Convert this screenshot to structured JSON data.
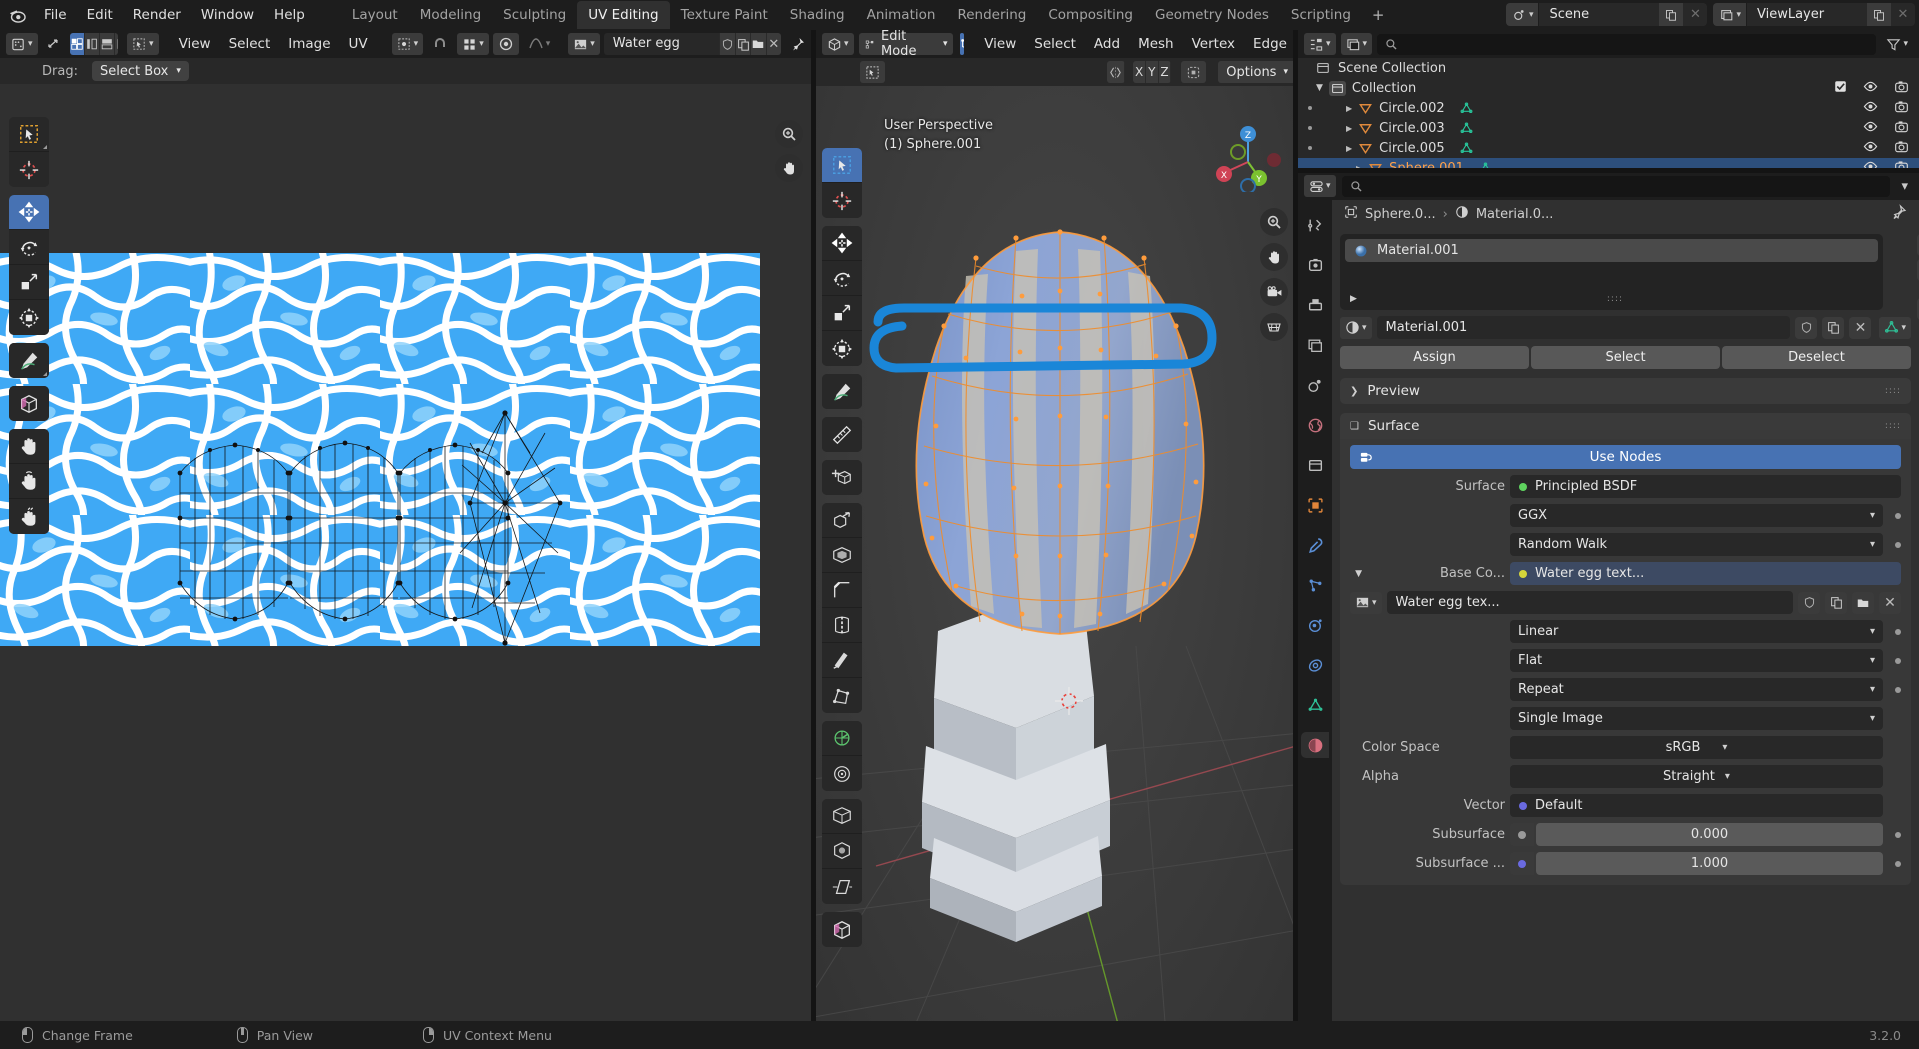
{
  "app": {
    "version": "3.2.0",
    "logo_icon": "blender-logo-icon"
  },
  "topbar": {
    "menus": [
      "File",
      "Edit",
      "Render",
      "Window",
      "Help"
    ],
    "workspaces": [
      {
        "label": "Layout",
        "active": false
      },
      {
        "label": "Modeling",
        "active": false
      },
      {
        "label": "Sculpting",
        "active": false
      },
      {
        "label": "UV Editing",
        "active": true
      },
      {
        "label": "Texture Paint",
        "active": false
      },
      {
        "label": "Shading",
        "active": false
      },
      {
        "label": "Animation",
        "active": false
      },
      {
        "label": "Rendering",
        "active": false
      },
      {
        "label": "Compositing",
        "active": false
      },
      {
        "label": "Geometry Nodes",
        "active": false
      },
      {
        "label": "Scripting",
        "active": false
      }
    ],
    "add_workspace_label": "+",
    "scene": {
      "name": "Scene",
      "icon": "scene-icon",
      "copy_label": "copy",
      "close_label": "×"
    },
    "viewlayer": {
      "name": "ViewLayer",
      "icon": "viewlayer-icon",
      "copy_label": "copy",
      "close_label": "×"
    }
  },
  "uv_editor": {
    "editor_type_icon": "uv-editor-icon",
    "menus": [
      "View",
      "Select",
      "Image",
      "UV"
    ],
    "image_name": "Water egg texture.jpg",
    "image_buttons": [
      "fake-user-shield-icon",
      "duplicate-icon",
      "open-folder-icon",
      "unlink-x-icon"
    ],
    "pin_icon": "pin-icon",
    "drag_label": "Drag:",
    "drag_value": "Select Box",
    "select_modes": [
      "vertex-select-icon",
      "edge-select-icon",
      "face-select-icon",
      "island-select-icon"
    ],
    "tools": [
      {
        "name": "tweak-select-box-tool",
        "icon": "cursor-box-icon",
        "active": false
      },
      {
        "name": "cursor-tool",
        "icon": "3d-cursor-icon",
        "active": false
      },
      {
        "name": "move-tool",
        "icon": "move-arrows-icon",
        "active": true
      },
      {
        "name": "rotate-tool",
        "icon": "rotate-icon",
        "active": false
      },
      {
        "name": "scale-tool",
        "icon": "scale-icon",
        "active": false
      },
      {
        "name": "transform-tool",
        "icon": "transform-icon",
        "active": false
      },
      {
        "name": "annotate-tool",
        "icon": "pencil-icon",
        "active": false
      },
      {
        "name": "rip-region-tool",
        "icon": "rip-region-icon",
        "active": false
      },
      {
        "name": "grab-tool",
        "icon": "hand-grab-icon",
        "active": false
      },
      {
        "name": "relax-tool",
        "icon": "hand-relax-icon",
        "active": false
      },
      {
        "name": "pinch-tool",
        "icon": "hand-pinch-icon",
        "active": false
      }
    ],
    "nav_buttons": [
      "zoom-icon",
      "pan-hand-icon"
    ]
  },
  "viewport": {
    "editor_type_icon": "3d-viewport-icon",
    "mode": "Edit Mode",
    "mesh_select_modes": [
      "vertex-mode-icon",
      "edge-mode-icon",
      "face-mode-icon"
    ],
    "menus": [
      "View",
      "Select",
      "Add",
      "Mesh",
      "Vertex",
      "Edge"
    ],
    "proportional_icon": "proportional-edit-icon",
    "axis_buttons": [
      "X",
      "Y",
      "Z"
    ],
    "snap_icon": "snap-icon",
    "options_label": "Options",
    "overlay_line1": "User Perspective",
    "overlay_line2": "(1) Sphere.001",
    "gizmo_axes": [
      "Z",
      "Y",
      "X"
    ],
    "nav_buttons": [
      "zoom-icon",
      "pan-hand-icon",
      "camera-icon",
      "grid-ortho-icon"
    ],
    "tools": [
      {
        "name": "tweak-tool",
        "icon": "cursor-box-icon",
        "active": true
      },
      {
        "name": "cursor-tool",
        "icon": "3d-cursor-icon",
        "active": false
      },
      {
        "name": "move-tool",
        "icon": "move-arrows-icon",
        "active": false
      },
      {
        "name": "rotate-tool",
        "icon": "rotate-icon",
        "active": false
      },
      {
        "name": "scale-tool",
        "icon": "scale-icon",
        "active": false
      },
      {
        "name": "transform-tool",
        "icon": "transform-icon",
        "active": false
      },
      {
        "name": "annotate-tool",
        "icon": "pencil-icon",
        "active": false
      },
      {
        "name": "measure-tool",
        "icon": "ruler-icon",
        "active": false
      },
      {
        "name": "add-cube-tool",
        "icon": "add-cube-icon",
        "active": false
      },
      {
        "name": "extrude-region-tool",
        "icon": "extrude-icon",
        "active": false
      },
      {
        "name": "inset-faces-tool",
        "icon": "inset-faces-icon",
        "active": false
      },
      {
        "name": "bevel-tool",
        "icon": "bevel-icon",
        "active": false
      },
      {
        "name": "loop-cut-tool",
        "icon": "loop-cut-icon",
        "active": false
      },
      {
        "name": "knife-tool",
        "icon": "knife-icon",
        "active": false
      },
      {
        "name": "poly-build-tool",
        "icon": "poly-build-icon",
        "active": false
      },
      {
        "name": "spin-tool",
        "icon": "spin-icon",
        "active": false
      },
      {
        "name": "smooth-tool",
        "icon": "smooth-icon",
        "active": false
      },
      {
        "name": "edge-slide-tool",
        "icon": "edge-slide-icon",
        "active": false
      },
      {
        "name": "shrink-fatten-tool",
        "icon": "shrink-fatten-icon",
        "active": false
      },
      {
        "name": "shear-tool",
        "icon": "shear-icon",
        "active": false
      },
      {
        "name": "rip-region-tool",
        "icon": "rip-region-icon",
        "active": false
      }
    ]
  },
  "outliner": {
    "display_mode_icon": "outliner-display-icon",
    "filter_icon": "filter-funnel-icon",
    "search_placeholder": "",
    "scene_collection": "Scene Collection",
    "collection": "Collection",
    "items": [
      {
        "name": "Circle.002",
        "selected": false,
        "type_icon": "mesh-object-icon",
        "data_icon": "mesh-data-icon"
      },
      {
        "name": "Circle.003",
        "selected": false,
        "type_icon": "mesh-object-icon",
        "data_icon": "mesh-data-icon"
      },
      {
        "name": "Circle.005",
        "selected": false,
        "type_icon": "mesh-object-icon",
        "data_icon": "mesh-data-icon"
      },
      {
        "name": "Sphere.001",
        "selected": true,
        "type_icon": "mesh-object-icon",
        "data_icon": "mesh-data-icon"
      }
    ],
    "row_toggles": [
      "checkbox",
      "eye-icon",
      "camera-icon"
    ]
  },
  "properties": {
    "editor_type_icon": "properties-icon",
    "search_placeholder": "",
    "breadcrumb": {
      "object": "Sphere.0...",
      "separator": "›",
      "material": "Material.0...",
      "pin_icon": "pin-icon"
    },
    "material_slot": "Material.001",
    "slot_buttons": [
      "+",
      "−",
      "⌄"
    ],
    "material_field": {
      "name": "Material.001",
      "browse_icon": "material-browse-icon",
      "buttons": [
        "fake-user-shield-icon",
        "new-material-icon",
        "unlink-x-icon"
      ],
      "specials_icon": "mesh-specials-icon"
    },
    "assign_buttons": [
      "Assign",
      "Select",
      "Deselect"
    ],
    "panels": [
      {
        "label": "Preview",
        "expanded": false
      },
      {
        "label": "Surface",
        "expanded": true
      }
    ],
    "use_nodes_label": "Use Nodes",
    "surface_label": "Surface",
    "surface_value": "Principled BSDF",
    "distribution": "GGX",
    "subsurface_method": "Random Walk",
    "base_color_label": "Base Co...",
    "base_color_value": "Water egg text...",
    "texture_field": {
      "browse_icon": "image-browse-icon",
      "name": "Water egg tex...",
      "buttons": [
        "fake-user-shield-icon",
        "new-image-icon",
        "open-folder-icon",
        "unlink-x-icon"
      ]
    },
    "interpolation": "Linear",
    "projection": "Flat",
    "extension": "Repeat",
    "source": "Single Image",
    "color_space_label": "Color Space",
    "color_space_value": "sRGB",
    "alpha_label": "Alpha",
    "alpha_value": "Straight",
    "vector_label": "Vector",
    "vector_value": "Default",
    "subsurface_label": "Subsurface",
    "subsurface_value": "0.000",
    "subsurface_radius_label": "Subsurface ...",
    "subsurface_radius_value": "1.000"
  },
  "statusbar": {
    "items": [
      {
        "label": "Change Frame",
        "mouse": "left"
      },
      {
        "label": "Pan View",
        "mouse": "middle"
      },
      {
        "label": "UV Context Menu",
        "mouse": "right"
      }
    ],
    "version": "3.2.0"
  },
  "colors": {
    "accent_blue": "#4772b3",
    "selected_orange": "#ffa14a",
    "water_blue": "#3fa9f5",
    "annotation_blue": "#1a86d8",
    "bg_dark": "#1d1d1d",
    "bg_panel": "#303030"
  }
}
